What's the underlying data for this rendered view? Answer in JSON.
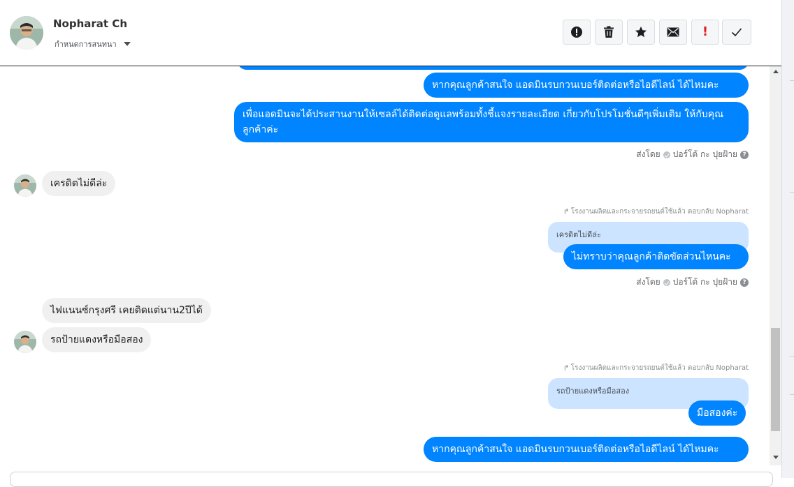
{
  "header": {
    "contact_name": "Nopharat Ch",
    "status_label": "กำหนดการสนทนา",
    "actions": [
      {
        "icon": "alert-circle-icon",
        "color": "#1c1e21"
      },
      {
        "icon": "trash-icon",
        "color": "#1c1e21"
      },
      {
        "icon": "star-icon",
        "color": "#1c1e21"
      },
      {
        "icon": "envelope-icon",
        "color": "#1c1e21"
      },
      {
        "icon": "exclamation-icon",
        "color": "#e02020",
        "glyph": "!"
      },
      {
        "icon": "check-icon",
        "color": "#1c1e21"
      }
    ]
  },
  "colors": {
    "outgoing_bubble": "#0084ff",
    "incoming_bubble": "#f0f0f0",
    "quoted_bubble": "#cce4ff"
  },
  "messages": {
    "out_1": "หากคุณลูกค้าสนใจ แอดมินรบกวนเบอร์ติดต่อหรือไอดีไลน์ ได้ไหมคะ",
    "out_2": "เพื่อแอดมินจะได้ประสานงานให้เซลล์ได้ติดต่อดูแลพร้อมทั้งชี้แจงรายละเอียด เกี่ยวกับโปรโมชั่นดีๆเพิ่มเติม ให้กับคุณลูกค้าค่ะ",
    "sent_by_1": "ส่งโดย",
    "agent_1": "ปอร์โต้ กะ ปุยฝ้าย",
    "in_1": "เครดิตไม่ดีล่ะ",
    "reply_note_1": "โรงงานผลิตและกระจายรถยนต์ใช้แล้ว ตอบกลับ Nopharat",
    "quote_1": "เครดิตไม่ดีล่ะ",
    "out_3": "ไม่ทราบว่าคุณลูกค้าติดขัดส่วนไหนคะ",
    "sent_by_2": "ส่งโดย",
    "agent_2": "ปอร์โต้ กะ ปุยฝ้าย",
    "in_2": "ไฟแนนซ์กรุงศรี เคยติดแต่นาน2ปีได้",
    "in_3": "รถป้ายแดงหรือมือสอง",
    "reply_note_2": "โรงงานผลิตและกระจายรถยนต์ใช้แล้ว ตอบกลับ Nopharat",
    "quote_2": "รถป้ายแดงหรือมือสอง",
    "out_4": "มือสองค่ะ",
    "out_5": "หากคุณลูกค้าสนใจ แอดมินรบกวนเบอร์ติดต่อหรือไอดีไลน์ ได้ไหมคะ"
  }
}
